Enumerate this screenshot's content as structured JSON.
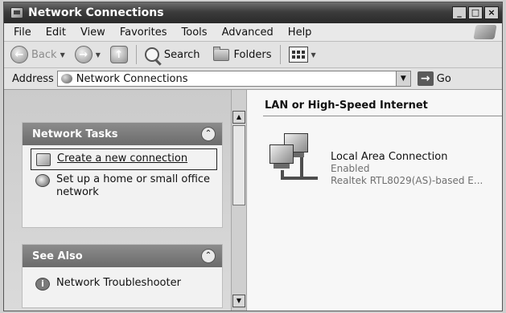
{
  "window": {
    "title": "Network Connections",
    "caption_buttons": [
      "_",
      "□",
      "×"
    ]
  },
  "menu": [
    "File",
    "Edit",
    "View",
    "Favorites",
    "Tools",
    "Advanced",
    "Help"
  ],
  "toolbar": {
    "back_label": "Back",
    "search_label": "Search",
    "folders_label": "Folders"
  },
  "address": {
    "label": "Address",
    "value": "Network Connections",
    "go_label": "Go"
  },
  "network_tasks": {
    "title": "Network Tasks",
    "items": [
      "Create a new connection",
      "Set up a home or small office network"
    ]
  },
  "see_also": {
    "title": "See Also",
    "items": [
      "Network Troubleshooter"
    ]
  },
  "content": {
    "group_title": "LAN or High-Speed Internet",
    "connection": {
      "name": "Local Area Connection",
      "status": "Enabled",
      "device": "Realtek RTL8029(AS)-based E..."
    }
  }
}
